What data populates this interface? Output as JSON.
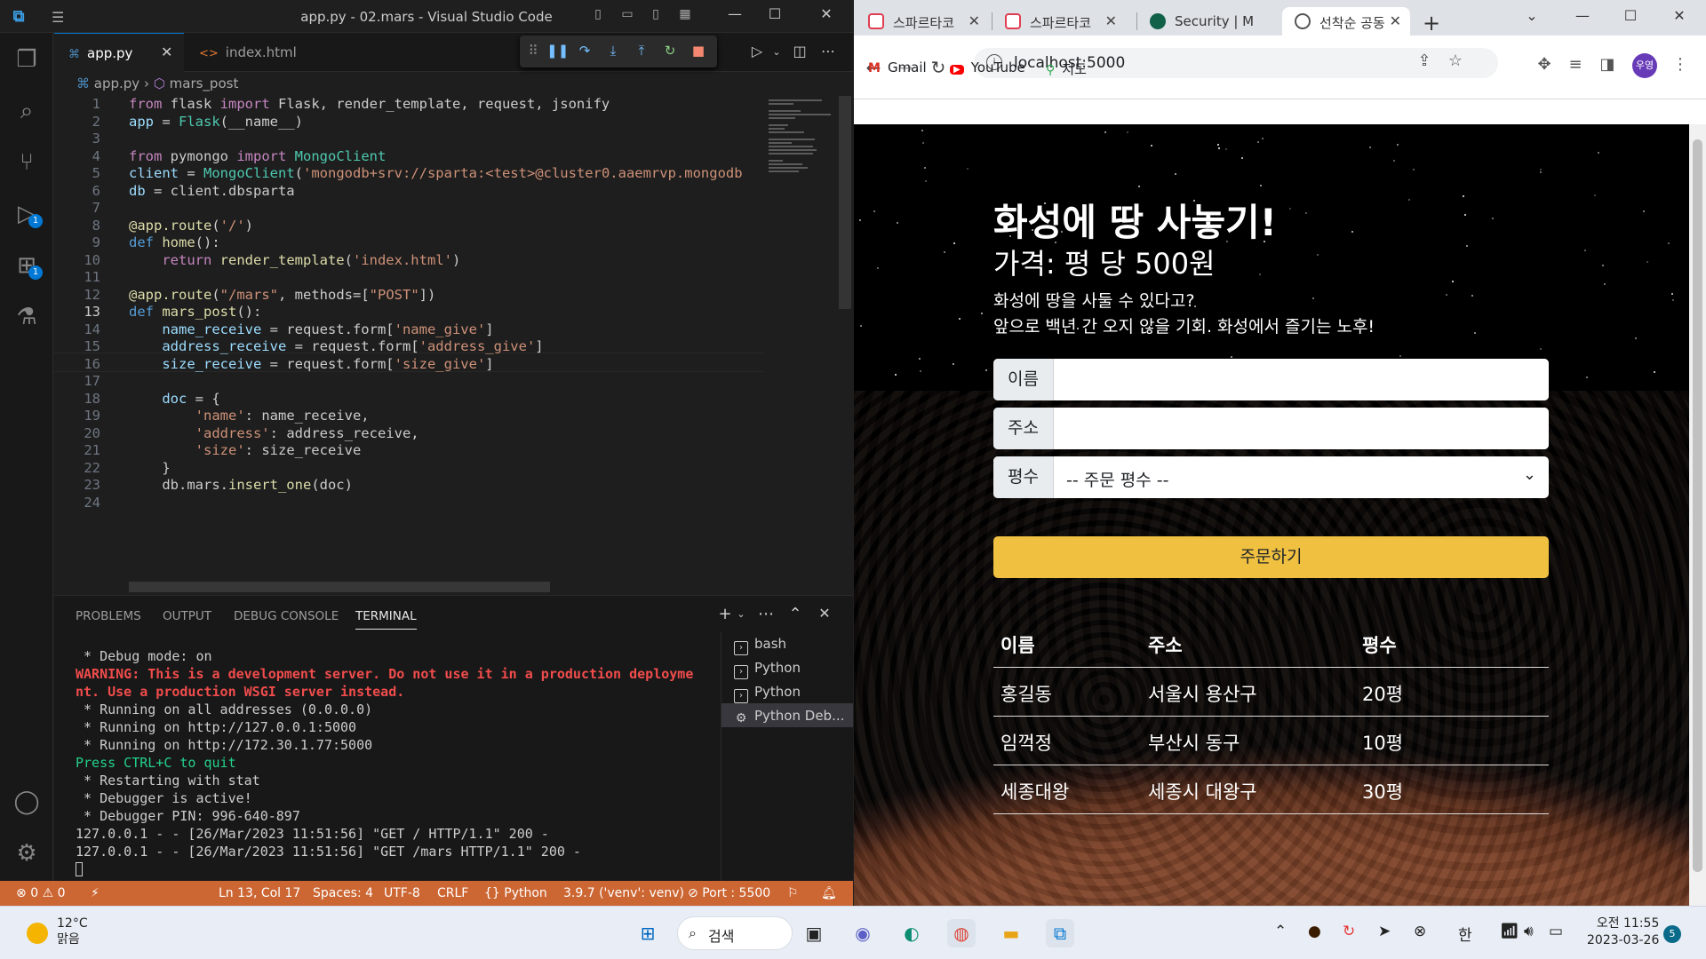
{
  "vscode": {
    "window_title": "app.py - 02.mars - Visual Studio Code",
    "tabs": [
      {
        "icon": "python-icon",
        "label": "app.py"
      },
      {
        "icon": "html-icon",
        "label": "index.html"
      }
    ],
    "breadcrumb": {
      "file": "app.py",
      "symbol": "mars_post"
    },
    "code_lines": [
      {
        "n": "1"
      },
      {
        "n": "2"
      },
      {
        "n": "3"
      },
      {
        "n": "4"
      },
      {
        "n": "5"
      },
      {
        "n": "6"
      },
      {
        "n": "7"
      },
      {
        "n": "8"
      },
      {
        "n": "9"
      },
      {
        "n": "10"
      },
      {
        "n": "11"
      },
      {
        "n": "12"
      },
      {
        "n": "13"
      },
      {
        "n": "14"
      },
      {
        "n": "15"
      },
      {
        "n": "16"
      },
      {
        "n": "17"
      },
      {
        "n": "18"
      },
      {
        "n": "19"
      },
      {
        "n": "20"
      },
      {
        "n": "21"
      },
      {
        "n": "22"
      },
      {
        "n": "23"
      },
      {
        "n": "24"
      }
    ],
    "code_text": {
      "l1a": "from",
      "l1b": " flask ",
      "l1c": "import",
      "l1d": " Flask, render_template, request, jsonify",
      "l2a": "app",
      "l2b": " = ",
      "l2c": "Flask",
      "l2d": "(__name__)",
      "l4a": "from",
      "l4b": " pymongo ",
      "l4c": "import",
      "l4d": " MongoClient",
      "l5a": "client",
      "l5b": " = ",
      "l5c": "MongoClient",
      "l5d": "(",
      "l5e": "'mongodb+srv://sparta:<test>@cluster0.aaemrvp.mongodb",
      "l6a": "db",
      "l6b": " = client.dbsparta",
      "l8a": "@app.route",
      "l8b": "(",
      "l8c": "'/'",
      "l8d": ")",
      "l9a": "def",
      "l9b": " home",
      "l9c": "():",
      "l10a": "    ",
      "l10b": "return",
      "l10c": " render_template",
      "l10d": "(",
      "l10e": "'index.html'",
      "l10f": ")",
      "l12a": "@app.route",
      "l12b": "(",
      "l12c": "\"/mars\"",
      "l12d": ", methods=[",
      "l12e": "\"POST\"",
      "l12f": "])",
      "l13a": "def",
      "l13b": " mars_post",
      "l13c": "():",
      "l14a": "    name_receive",
      "l14b": " = request.form[",
      "l14c": "'name_give'",
      "l14d": "]",
      "l15a": "    address_receive",
      "l15b": " = request.form[",
      "l15c": "'address_give'",
      "l15d": "]",
      "l16a": "    size_receive",
      "l16b": " = request.form[",
      "l16c": "'size_give'",
      "l16d": "]",
      "l18a": "    doc",
      "l18b": " = {",
      "l19a": "        ",
      "l19b": "'name'",
      "l19c": ": name_receive,",
      "l20a": "        ",
      "l20b": "'address'",
      "l20c": ": address_receive,",
      "l21a": "        ",
      "l21b": "'size'",
      "l21c": ": size_receive",
      "l22a": "    }",
      "l23a": "    db.mars.",
      "l23b": "insert_one",
      "l23c": "(doc)"
    },
    "panel_tabs": [
      "PROBLEMS",
      "OUTPUT",
      "DEBUG CONSOLE",
      "TERMINAL"
    ],
    "terminal_lines": [
      " * Debug mode: on",
      "WARNING: This is a development server. Do not use it in a production deployme",
      "nt. Use a production WSGI server instead.",
      " * Running on all addresses (0.0.0.0)",
      " * Running on http://127.0.0.1:5000",
      " * Running on http://172.30.1.77:5000",
      "Press CTRL+C to quit",
      " * Restarting with stat",
      " * Debugger is active!",
      " * Debugger PIN: 996-640-897",
      "127.0.0.1 - - [26/Mar/2023 11:51:56] \"GET / HTTP/1.1\" 200 -",
      "127.0.0.1 - - [26/Mar/2023 11:51:56] \"GET /mars HTTP/1.1\" 200 -"
    ],
    "terminal_list": [
      "bash",
      "Python",
      "Python",
      "Python Deb..."
    ],
    "status": {
      "errors": "0",
      "warnings": "0",
      "position": "Ln 13, Col 17",
      "spaces": "Spaces: 4",
      "encoding": "UTF-8",
      "eol": "CRLF",
      "language": "Python",
      "interpreter": "3.9.7 ('venv': venv)",
      "port": "Port : 5500"
    },
    "badges": {
      "debug": "1",
      "extensions": "1"
    }
  },
  "browser": {
    "tabs": [
      {
        "label": "스파르타코"
      },
      {
        "label": "스파르타코"
      },
      {
        "label": "Security | M"
      },
      {
        "label": "선착순 공동"
      }
    ],
    "url": "localhost:5000",
    "profile": "우영",
    "bookmarks": [
      "Gmail",
      "YouTube",
      "지도"
    ],
    "page": {
      "title": "화성에 땅 사놓기!",
      "subtitle": "가격: 평 당 500원",
      "desc1": "화성에 땅을 사둘 수 있다고?",
      "desc2": "앞으로 백년 간 오지 않을 기회. 화성에서 즐기는 노후!",
      "name_label": "이름",
      "address_label": "주소",
      "size_label": "평수",
      "size_selected": "-- 주문 평수 --",
      "order_button": "주문하기",
      "table_headers": [
        "이름",
        "주소",
        "평수"
      ],
      "rows": [
        [
          "홍길동",
          "서울시 용산구",
          "20평"
        ],
        [
          "임꺽정",
          "부산시 동구",
          "10평"
        ],
        [
          "세종대왕",
          "세종시 대왕구",
          "30평"
        ]
      ]
    }
  },
  "taskbar": {
    "temp": "12°C",
    "weather": "맑음",
    "search": "검색",
    "ime": "한",
    "time": "오전 11:55",
    "date": "2023-03-26",
    "notifications": "5"
  },
  "colors": {
    "status_bar": "#cc6633",
    "order_button": "#f0c040",
    "accent": "#0078d4"
  }
}
